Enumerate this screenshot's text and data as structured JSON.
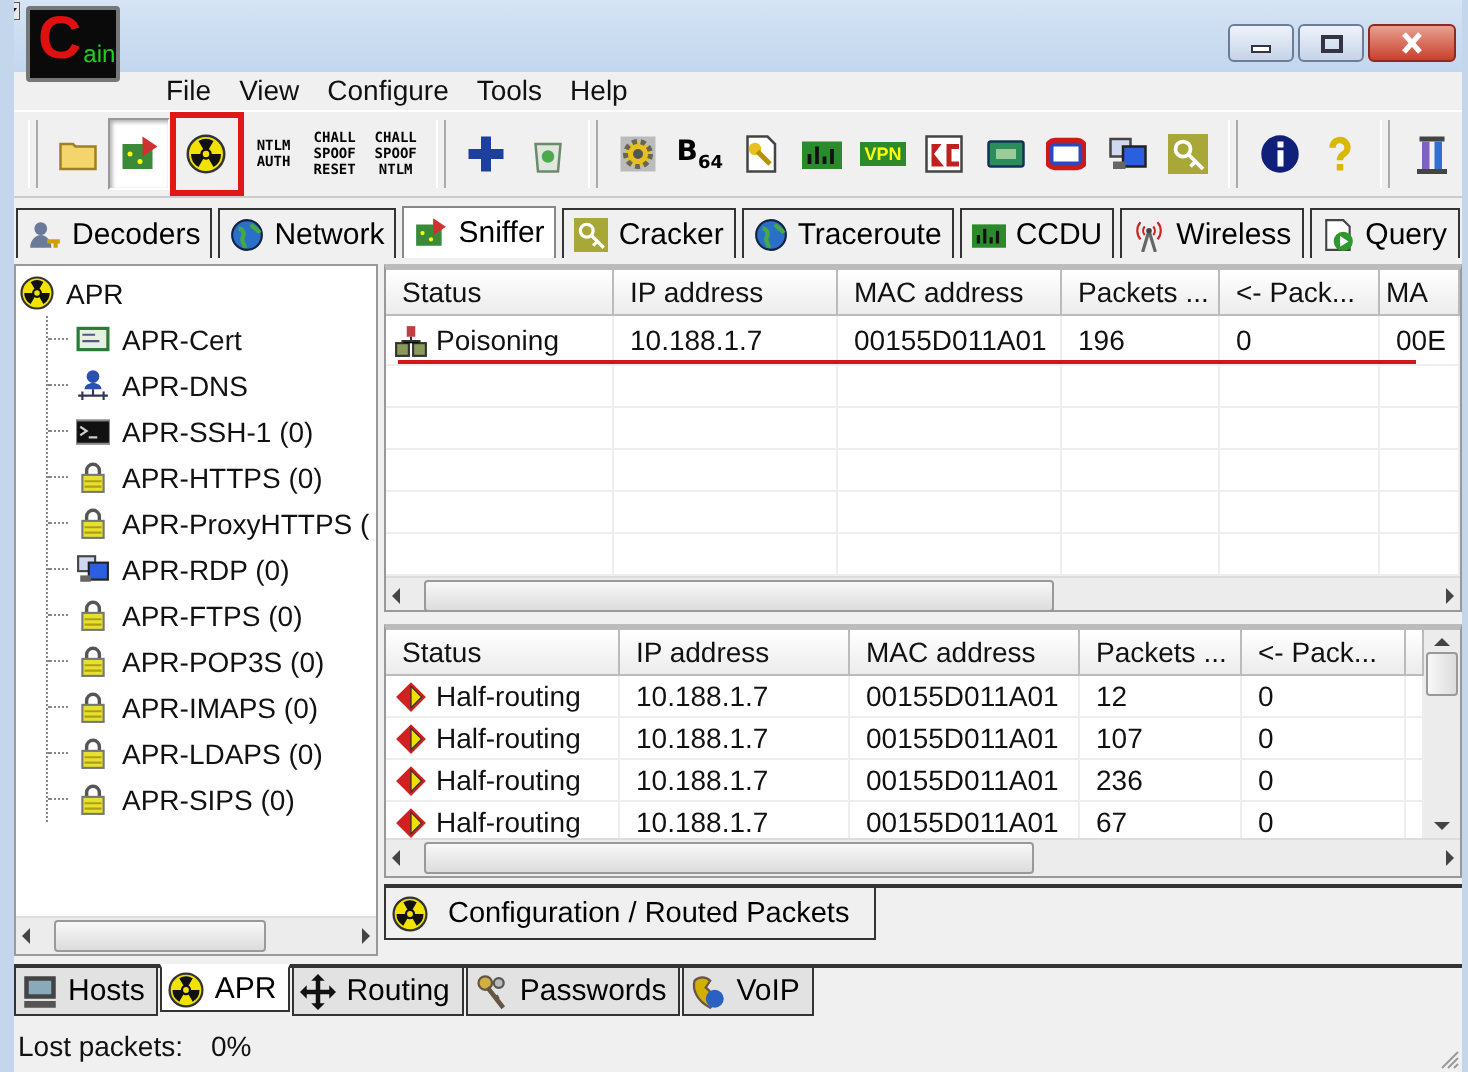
{
  "window": {
    "logo_initial": "C",
    "logo_rest": "ain"
  },
  "menu": [
    "File",
    "View",
    "Configure",
    "Tools",
    "Help"
  ],
  "toolbar_groups": [
    [
      {
        "kind": "folder",
        "selected": false,
        "highlighted": false
      },
      {
        "kind": "board",
        "selected": true,
        "highlighted": false
      },
      {
        "kind": "radiation",
        "selected": false,
        "highlighted": true
      },
      {
        "kind": "text",
        "lines": [
          "NTLM",
          "AUTH"
        ],
        "selected": false,
        "highlighted": false
      },
      {
        "kind": "text",
        "lines": [
          "CHALL",
          "SPOOF",
          "RESET"
        ],
        "selected": false,
        "highlighted": false
      },
      {
        "kind": "text",
        "lines": [
          "CHALL",
          "SPOOF",
          "NTLM"
        ],
        "selected": false,
        "highlighted": false
      }
    ],
    [
      {
        "kind": "plus",
        "selected": false,
        "highlighted": false
      },
      {
        "kind": "bin",
        "selected": false,
        "highlighted": false
      }
    ],
    [
      {
        "kind": "gear",
        "selected": false,
        "highlighted": false
      },
      {
        "kind": "b64",
        "label": "B$_{64}$",
        "selected": false,
        "highlighted": false
      },
      {
        "kind": "keydoc",
        "selected": false,
        "highlighted": false
      },
      {
        "kind": "meter",
        "selected": false,
        "highlighted": false
      },
      {
        "kind": "vpn",
        "label": "VPN",
        "selected": false,
        "highlighted": false
      },
      {
        "kind": "rc",
        "selected": false,
        "highlighted": false
      },
      {
        "kind": "display",
        "selected": false,
        "highlighted": false
      },
      {
        "kind": "monitor",
        "selected": false,
        "highlighted": false
      },
      {
        "kind": "computers",
        "selected": false,
        "highlighted": false
      },
      {
        "kind": "key",
        "selected": false,
        "highlighted": false
      }
    ],
    [
      {
        "kind": "info",
        "selected": false,
        "highlighted": false
      },
      {
        "kind": "help",
        "selected": false,
        "highlighted": false
      }
    ],
    [
      {
        "kind": "pillar",
        "selected": false,
        "highlighted": false
      }
    ]
  ],
  "module_tabs": [
    {
      "label": "Decoders",
      "kind": "userkey",
      "selected": false
    },
    {
      "label": "Network",
      "kind": "globe",
      "selected": false
    },
    {
      "label": "Sniffer",
      "kind": "board",
      "selected": true
    },
    {
      "label": "Cracker",
      "kind": "key",
      "selected": false
    },
    {
      "label": "Traceroute",
      "kind": "globe",
      "selected": false
    },
    {
      "label": "CCDU",
      "kind": "meter",
      "selected": false
    },
    {
      "label": "Wireless",
      "kind": "antenna",
      "selected": false
    },
    {
      "label": "Query",
      "kind": "query",
      "selected": false
    }
  ],
  "tree": {
    "label": "APR",
    "kind": "radiation",
    "children": [
      {
        "label": "APR-Cert",
        "kind": "cert"
      },
      {
        "label": "APR-DNS",
        "kind": "dns"
      },
      {
        "label": "APR-SSH-1 (0)",
        "kind": "terminal"
      },
      {
        "label": "APR-HTTPS (0)",
        "kind": "lock"
      },
      {
        "label": "APR-ProxyHTTPS (",
        "kind": "lock"
      },
      {
        "label": "APR-RDP (0)",
        "kind": "computers"
      },
      {
        "label": "APR-FTPS (0)",
        "kind": "lock"
      },
      {
        "label": "APR-POP3S (0)",
        "kind": "lock"
      },
      {
        "label": "APR-IMAPS (0)",
        "kind": "lock"
      },
      {
        "label": "APR-LDAPS (0)",
        "kind": "lock"
      },
      {
        "label": "APR-SIPS (0)",
        "kind": "lock"
      }
    ]
  },
  "top_table": {
    "columns": [
      "Status",
      "IP address",
      "MAC address",
      "Packets ...",
      "<- Pack...",
      "MA"
    ],
    "rows": [
      {
        "kind": "poison",
        "cells": [
          "Poisoning",
          "10.188.1.7",
          "00155D011A01",
          "196",
          "0",
          "00E"
        ],
        "underlined": true
      }
    ]
  },
  "bottom_table": {
    "columns": [
      "Status",
      "IP address",
      "MAC address",
      "Packets ...",
      "<- Pack..."
    ],
    "rows": [
      {
        "kind": "halfroute",
        "cells": [
          "Half-routing",
          "10.188.1.7",
          "00155D011A01",
          "12",
          "0"
        ]
      },
      {
        "kind": "halfroute",
        "cells": [
          "Half-routing",
          "10.188.1.7",
          "00155D011A01",
          "107",
          "0"
        ]
      },
      {
        "kind": "halfroute",
        "cells": [
          "Half-routing",
          "10.188.1.7",
          "00155D011A01",
          "236",
          "0"
        ]
      },
      {
        "kind": "halfroute",
        "cells": [
          "Half-routing",
          "10.188.1.7",
          "00155D011A01",
          "67",
          "0"
        ]
      }
    ]
  },
  "pane_tab": {
    "label": "Configuration / Routed Packets",
    "kind": "radiation"
  },
  "bottom_tabs": [
    {
      "label": "Hosts",
      "kind": "hosts",
      "selected": false
    },
    {
      "label": "APR",
      "kind": "radiation",
      "selected": true
    },
    {
      "label": "Routing",
      "kind": "move",
      "selected": false
    },
    {
      "label": "Passwords",
      "kind": "keys",
      "selected": false
    },
    {
      "label": "VoIP",
      "kind": "phone",
      "selected": false
    }
  ],
  "status_bar": {
    "label": "Lost packets:",
    "value": "0%"
  }
}
